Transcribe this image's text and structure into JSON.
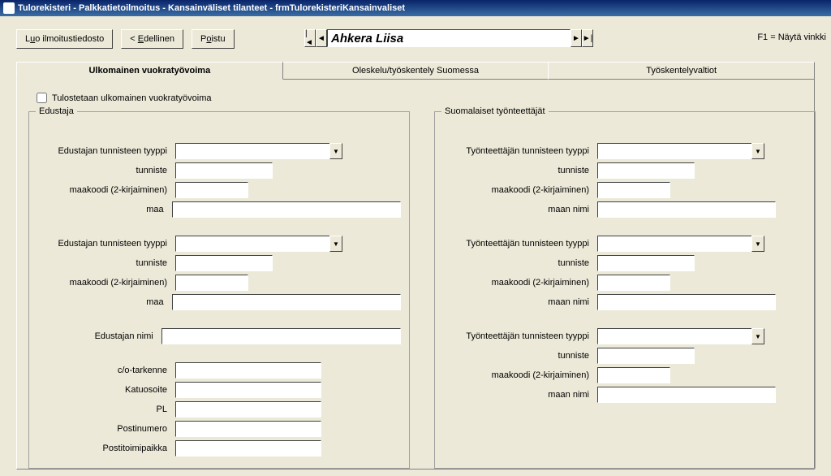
{
  "window": {
    "title": "Tulorekisteri - Palkkatietoilmoitus - Kansainväliset tilanteet - frmTulorekisteriKansainvaliset"
  },
  "toolbar": {
    "create": {
      "pre": "L",
      "u": "u",
      "post": "o ilmoitustiedosto"
    },
    "prev": {
      "pre": "< ",
      "u": "E",
      "post": "dellinen"
    },
    "exit": {
      "pre": "P",
      "u": "o",
      "post": "istu"
    }
  },
  "nav": {
    "name": "Ahkera Liisa",
    "first": "|◄",
    "prev": "◄",
    "next": "►",
    "last": "►|"
  },
  "hint": "F1 = Näytä vinkki",
  "tabs": {
    "t1": "Ulkomainen vuokratyövoima",
    "t2": "Oleskelu/työskentely Suomessa",
    "t3": "Työskentelyvaltiot"
  },
  "checkbox": "Tulostetaan ulkomainen vuokratyövoima",
  "groupA": {
    "legend": "Edustaja",
    "r1": "Edustajan tunnisteen tyyppi",
    "r2": "tunniste",
    "r3": "maakoodi (2-kirjaiminen)",
    "r4": "maa",
    "r5": "Edustajan tunnisteen tyyppi",
    "r6": "tunniste",
    "r7": "maakoodi (2-kirjaiminen)",
    "r8": "maa",
    "r9": "Edustajan nimi",
    "r10": "c/o-tarkenne",
    "r11": "Katuosoite",
    "r12": "PL",
    "r13": "Postinumero",
    "r14": "Postitoimipaikka"
  },
  "groupB": {
    "legend": "Suomalaiset työnteettäjät",
    "r1": "Työnteettäjän tunnisteen tyyppi",
    "r2": "tunniste",
    "r3": "maakoodi (2-kirjaiminen)",
    "r4": "maan nimi",
    "r5": "Työnteettäjän tunnisteen tyyppi",
    "r6": "tunniste",
    "r7": "maakoodi (2-kirjaiminen)",
    "r8": "maan nimi",
    "r9": "Työnteettäjän tunnisteen tyyppi",
    "r10": "tunniste",
    "r11": "maakoodi (2-kirjaiminen)",
    "r12": "maan nimi"
  }
}
